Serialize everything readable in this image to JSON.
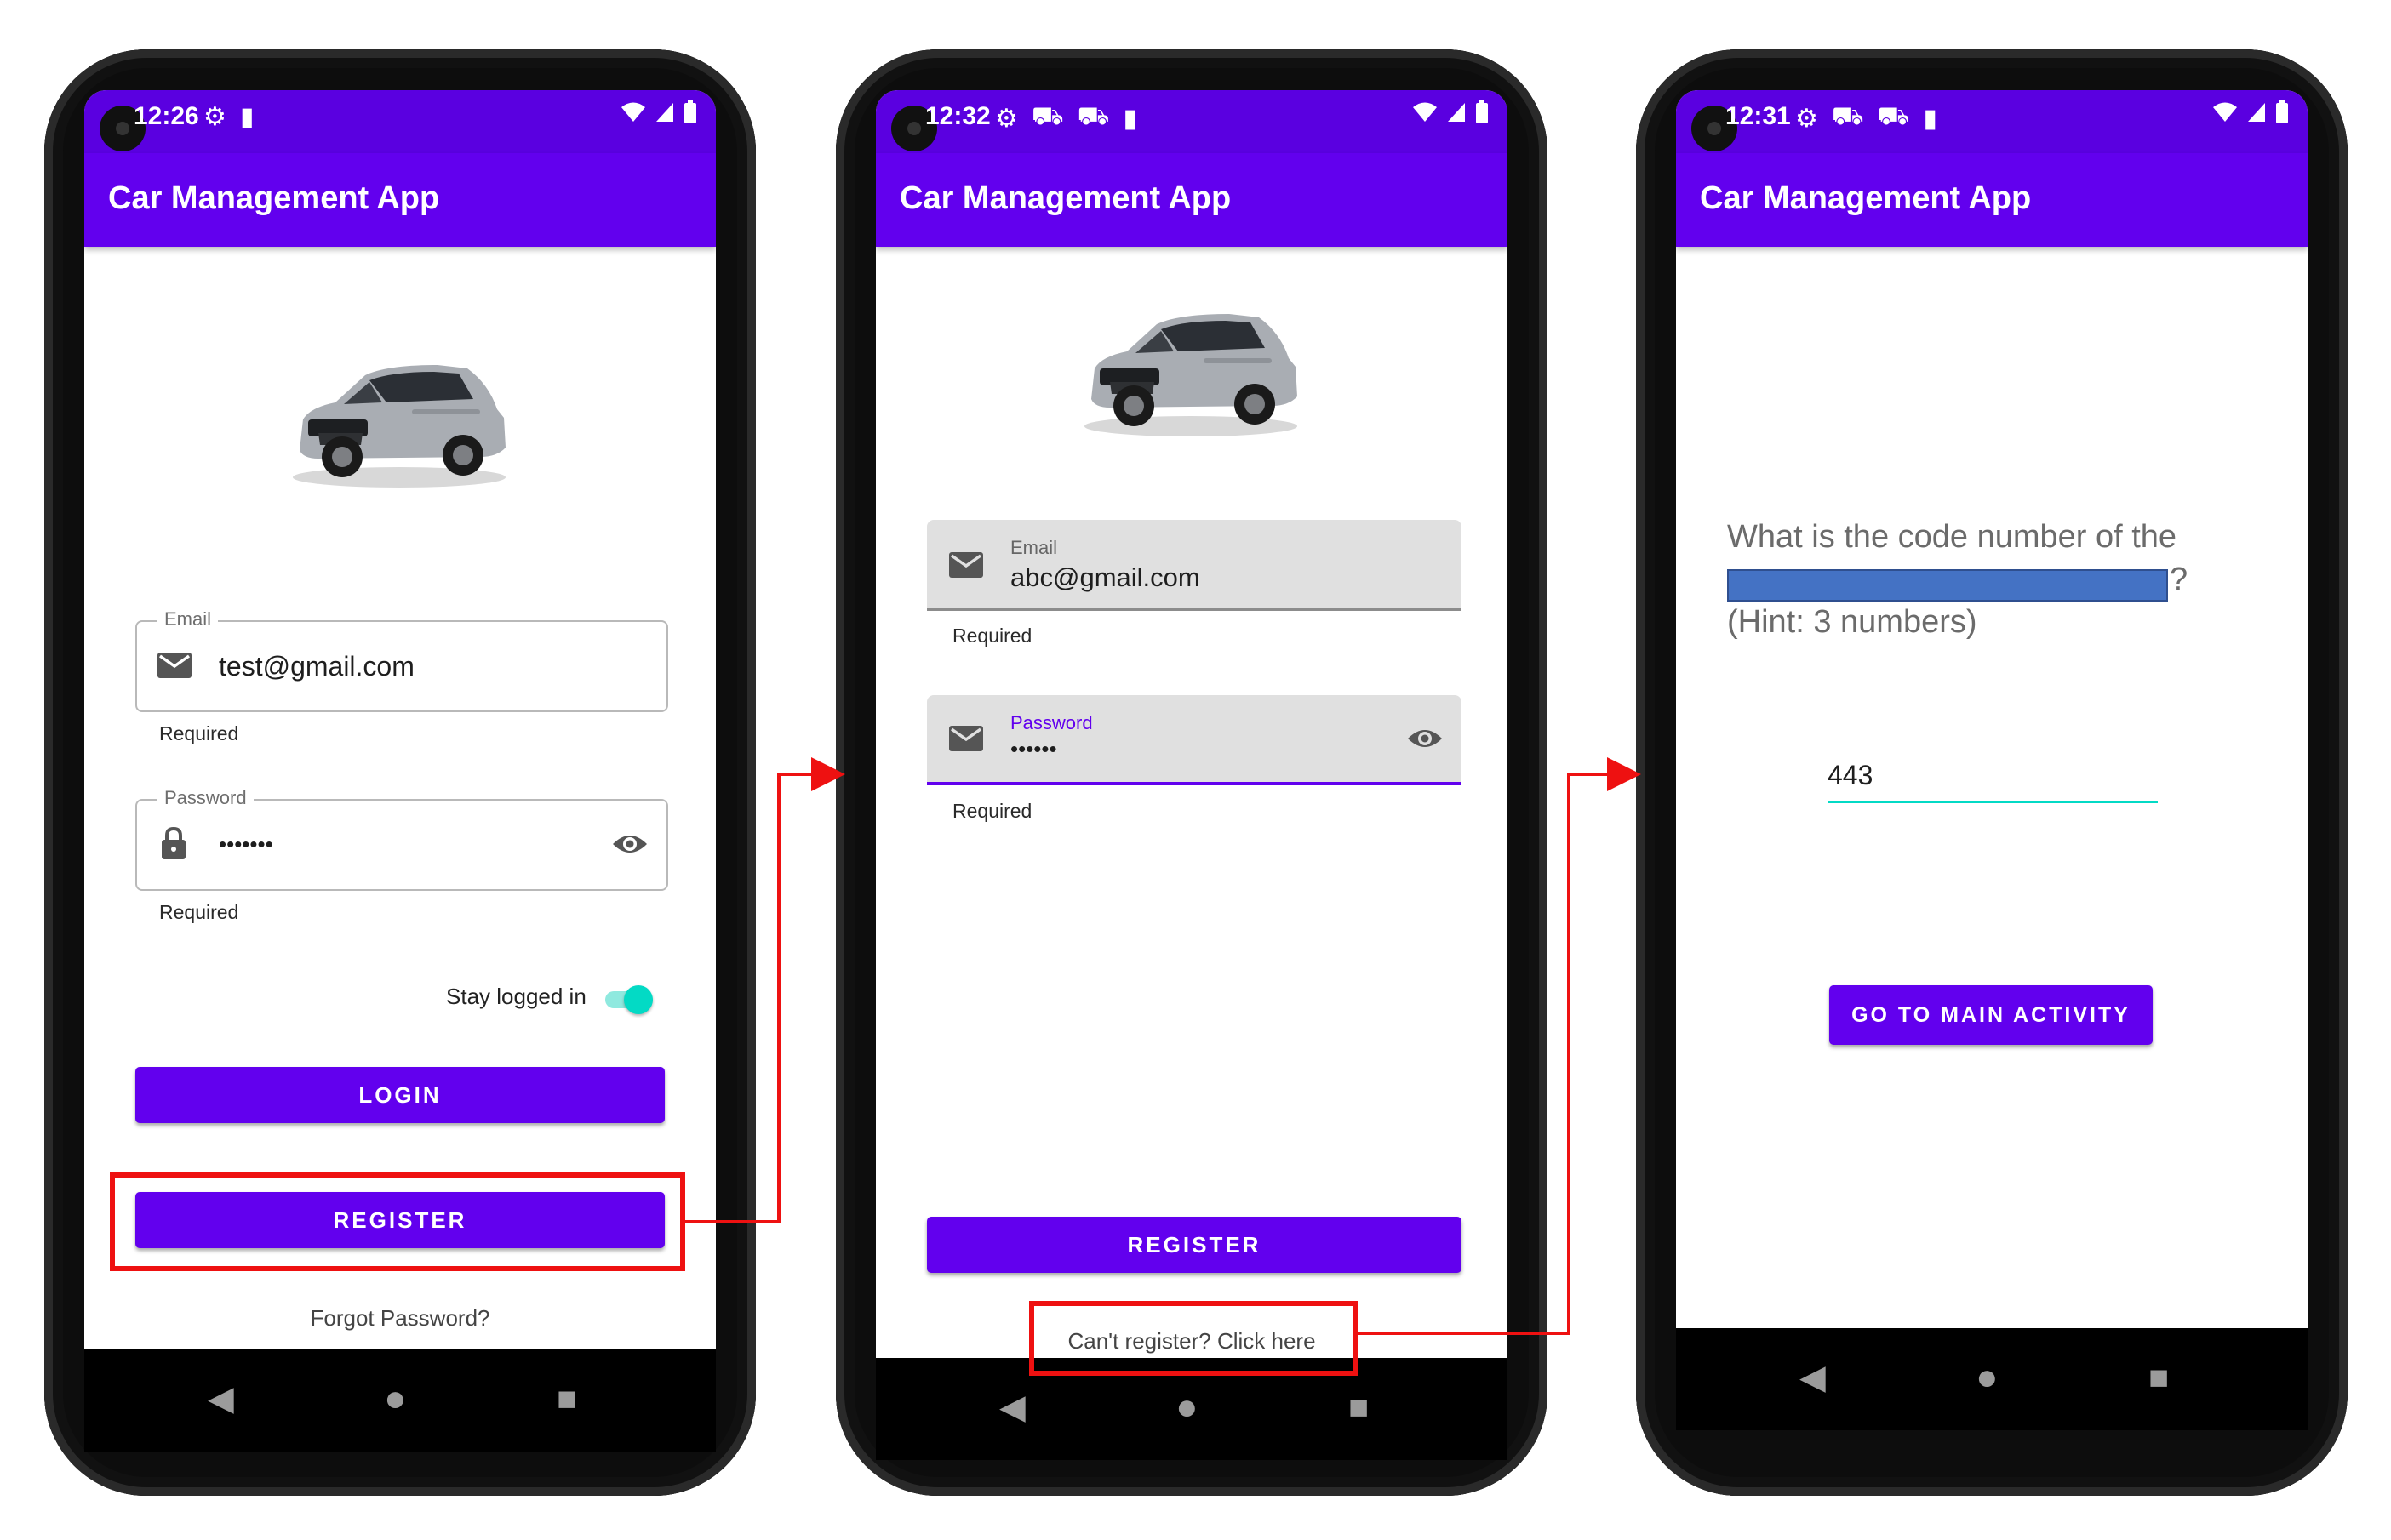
{
  "app_title": "Car Management App",
  "phone1": {
    "status_time": "12:26",
    "email_label": "Email",
    "email_value": "test@gmail.com",
    "email_helper": "Required",
    "password_label": "Password",
    "password_value": "•••••••",
    "password_helper": "Required",
    "stay_logged_in_label": "Stay logged in",
    "stay_logged_in_on": true,
    "login_button": "LOGIN",
    "register_button": "REGISTER",
    "forgot_password_link": "Forgot Password?"
  },
  "phone2": {
    "status_time": "12:32",
    "email_label": "Email",
    "email_value": "abc@gmail.com",
    "email_helper": "Required",
    "password_label": "Password",
    "password_value": "••••••",
    "password_helper": "Required",
    "register_button": "REGISTER",
    "cant_register_link": "Can't register? Click here"
  },
  "phone3": {
    "status_time": "12:31",
    "question_line1": "What is the code number of the",
    "question_line2_suffix": "?",
    "question_hint": "(Hint: 3 numbers)",
    "code_value": "443",
    "go_main_button": "GO TO MAIN ACTIVITY"
  },
  "colors": {
    "primary": "#6200ee",
    "status_bar": "#5a00e0",
    "accent_teal": "#03dac5",
    "highlight_red": "#ee1111",
    "redaction_blue": "#4472c4"
  }
}
